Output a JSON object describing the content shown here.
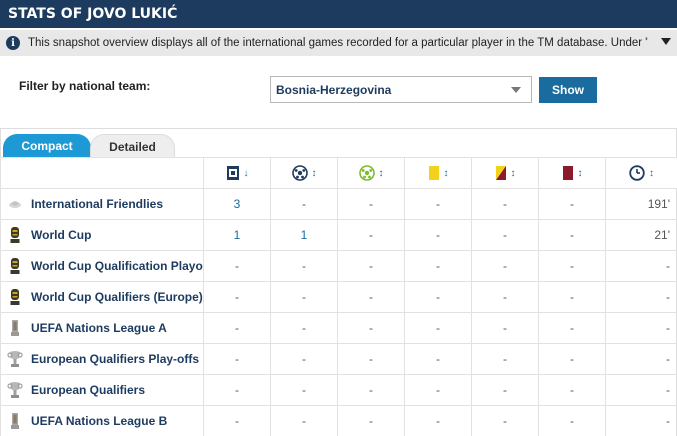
{
  "header": {
    "title": "Stats of Jovo Lukić"
  },
  "info": {
    "text": "This snapshot overview displays all of the international games recorded for a particular player in the TM database. Under \"Filter by national te..."
  },
  "filter": {
    "label": "Filter by national team:",
    "selected": "Bosnia-Herzegovina",
    "button": "Show"
  },
  "tabs": {
    "compact": "Compact",
    "detailed": "Detailed"
  },
  "columns": [
    {
      "icon": "appearances-icon",
      "sort": "↓"
    },
    {
      "icon": "goals-icon",
      "sort": "↕"
    },
    {
      "icon": "assists-icon",
      "sort": "↕"
    },
    {
      "icon": "yellow-card-icon",
      "sort": "↕",
      "color": "#f2d21b"
    },
    {
      "icon": "second-yellow-icon",
      "sort": "↕"
    },
    {
      "icon": "red-card-icon",
      "sort": "↕",
      "color": "#8b1a2b"
    },
    {
      "icon": "minutes-icon",
      "sort": "↕"
    }
  ],
  "rows": [
    {
      "name": "International Friendlies",
      "icon": "friendly-icon",
      "values": [
        "3",
        "-",
        "-",
        "-",
        "-",
        "-",
        "191'"
      ]
    },
    {
      "name": "World Cup",
      "icon": "world-cup-trophy-icon",
      "values": [
        "1",
        "1",
        "-",
        "-",
        "-",
        "-",
        "21'"
      ]
    },
    {
      "name": "World Cup Qualification Playoffs",
      "icon": "world-cup-trophy-icon",
      "values": [
        "-",
        "-",
        "-",
        "-",
        "-",
        "-",
        "-"
      ]
    },
    {
      "name": "World Cup Qualifiers (Europe)",
      "icon": "world-cup-trophy-icon",
      "values": [
        "-",
        "-",
        "-",
        "-",
        "-",
        "-",
        "-"
      ]
    },
    {
      "name": "UEFA Nations League A",
      "icon": "nations-league-icon",
      "values": [
        "-",
        "-",
        "-",
        "-",
        "-",
        "-",
        "-"
      ]
    },
    {
      "name": "European Qualifiers Play-offs",
      "icon": "euro-trophy-icon",
      "values": [
        "-",
        "-",
        "-",
        "-",
        "-",
        "-",
        "-"
      ]
    },
    {
      "name": "European Qualifiers",
      "icon": "euro-trophy-icon",
      "values": [
        "-",
        "-",
        "-",
        "-",
        "-",
        "-",
        "-"
      ]
    },
    {
      "name": "UEFA Nations League B",
      "icon": "nations-league-icon",
      "values": [
        "-",
        "-",
        "-",
        "-",
        "-",
        "-",
        "-"
      ]
    }
  ]
}
